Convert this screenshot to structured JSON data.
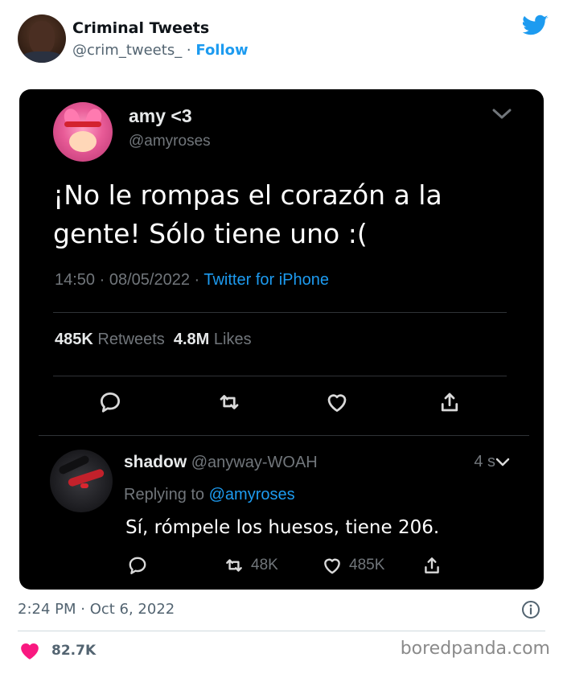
{
  "embed": {
    "account_name": "Criminal Tweets",
    "handle": "@crim_tweets_",
    "separator": " · ",
    "follow_label": "Follow",
    "timestamp": "2:24 PM · Oct 6, 2022",
    "like_count": "82.7K",
    "accent_color": "#1d9bf0",
    "like_color": "#f91880"
  },
  "screenshot": {
    "author_name": "amy <3",
    "author_handle": "@amyroses",
    "text": "¡No le rompas el corazón a la gente! Sólo tiene uno :(",
    "time": "14:50",
    "date": "08/05/2022",
    "source": "Twitter for iPhone",
    "retweets_count": "485K",
    "retweets_label": "Retweets",
    "likes_count": "4.8M",
    "likes_label": "Likes",
    "reply": {
      "author_name": "shadow",
      "author_handle": "@anyway-WOAH",
      "time_ago": "4 s",
      "replying_prefix": "Replying to",
      "replying_mention": "@amyroses",
      "text": "Sí, rómpele los huesos, tiene 206.",
      "retweets": "48K",
      "likes": "485K"
    }
  },
  "watermark": "boredpanda.com"
}
